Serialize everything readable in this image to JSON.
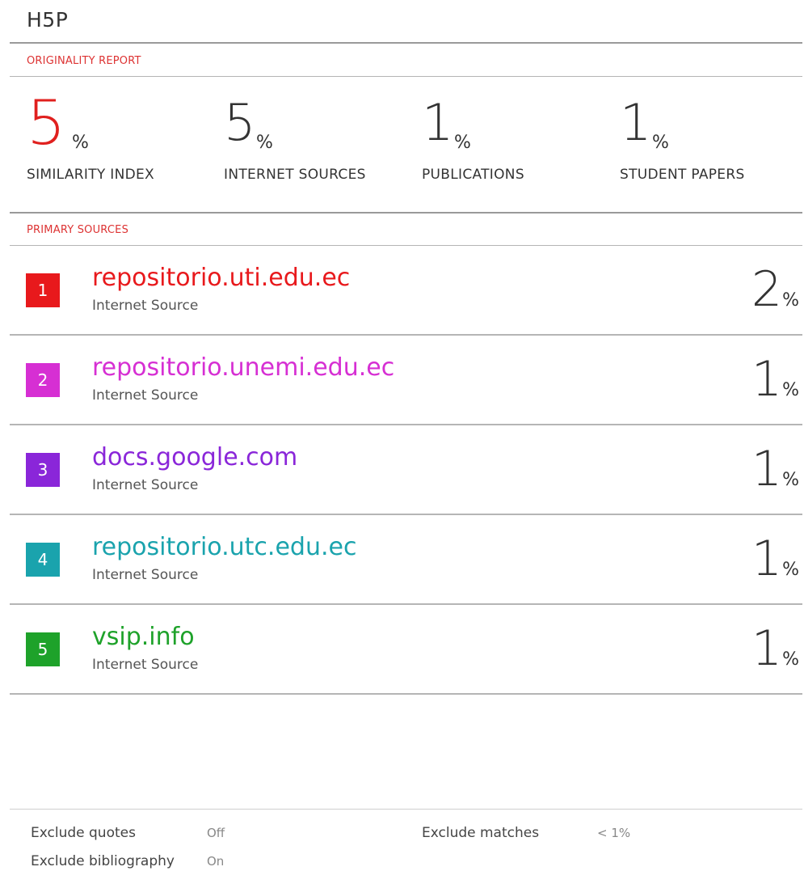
{
  "document": {
    "title": "H5P"
  },
  "report": {
    "originality_label": "ORIGINALITY REPORT",
    "stats": [
      {
        "value": "5",
        "unit": "%",
        "label": "SIMILARITY INDEX"
      },
      {
        "value": "5",
        "unit": "%",
        "label": "INTERNET SOURCES"
      },
      {
        "value": "1",
        "unit": "%",
        "label": "PUBLICATIONS"
      },
      {
        "value": "1",
        "unit": "%",
        "label": "STUDENT PAPERS"
      }
    ],
    "highlight_color": "#e0201e"
  },
  "primary_sources": {
    "label": "PRIMARY SOURCES",
    "items": [
      {
        "rank": "1",
        "name": "repositorio.uti.edu.ec",
        "type": "Internet Source",
        "value": "2",
        "unit": "%",
        "color": "#e8191c"
      },
      {
        "rank": "2",
        "name": "repositorio.unemi.edu.ec",
        "type": "Internet Source",
        "value": "1",
        "unit": "%",
        "color": "#d62fd3"
      },
      {
        "rank": "3",
        "name": "docs.google.com",
        "type": "Internet Source",
        "value": "1",
        "unit": "%",
        "color": "#8a26d9"
      },
      {
        "rank": "4",
        "name": "repositorio.utc.edu.ec",
        "type": "Internet Source",
        "value": "1",
        "unit": "%",
        "color": "#1aa3ad"
      },
      {
        "rank": "5",
        "name": "vsip.info",
        "type": "Internet Source",
        "value": "1",
        "unit": "%",
        "color": "#1ea22a"
      }
    ]
  },
  "settings": {
    "exclude_quotes_label": "Exclude quotes",
    "exclude_quotes_value": "Off",
    "exclude_bibliography_label": "Exclude bibliography",
    "exclude_bibliography_value": "On",
    "exclude_matches_label": "Exclude matches",
    "exclude_matches_value": "< 1%"
  }
}
